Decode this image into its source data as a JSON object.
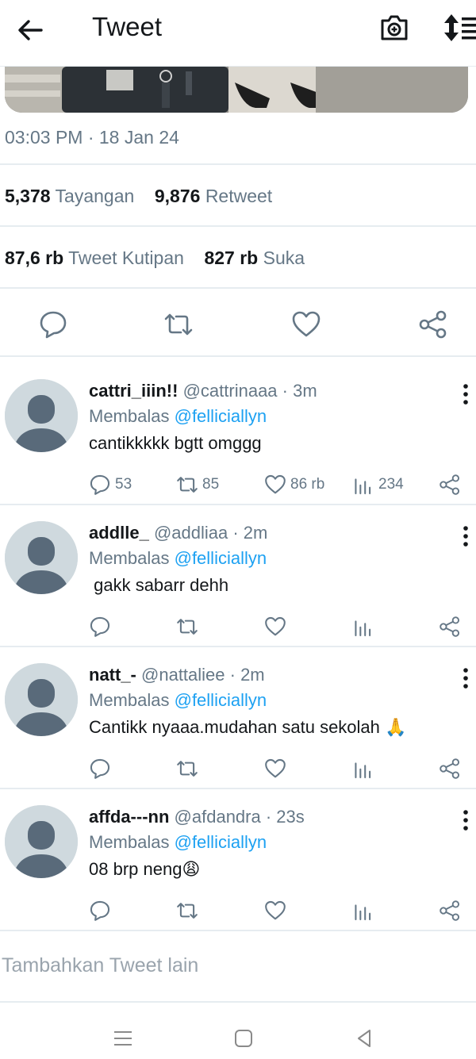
{
  "header": {
    "title": "Tweet"
  },
  "tweet": {
    "timestamp": "03:03 PM · 18 Jan 24",
    "views_count": "5,378",
    "views_label": "Tayangan",
    "retweets_count": "9,876",
    "retweets_label": "Retweet",
    "quotes_count": "87,6 rb",
    "quotes_label": "Tweet Kutipan",
    "likes_count": "827 rb",
    "likes_label": "Suka"
  },
  "replies": [
    {
      "name": "cattri_iiin!!",
      "handle": "@cattrinaaa · 3m",
      "reply_prefix": "Membalas",
      "mention": "@fellicially​n",
      "text": "cantikkkkk bgtt omggg",
      "replies": "53",
      "retweets": "85",
      "likes": "86 rb",
      "views": "234"
    },
    {
      "name": "addlle_",
      "handle": "@addliaa · 2m",
      "reply_prefix": "Membalas",
      "mention": "@felliciallyn",
      "text": " gakk sabarr dehh",
      "replies": "",
      "retweets": "",
      "likes": "",
      "views": ""
    },
    {
      "name": "natt_-",
      "handle": "@nattaliee · 2m",
      "reply_prefix": "Membalas",
      "mention": "@felliciallyn",
      "text": "Cantikk nyaaa.mudahan satu sekolah 🙏",
      "replies": "",
      "retweets": "",
      "likes": "",
      "views": ""
    },
    {
      "name": "affda---nn",
      "handle": "@afdandra · 23s",
      "reply_prefix": "Membalas",
      "mention": "@felliciallyn",
      "text": "08 brp neng😩",
      "replies": "",
      "retweets": "",
      "likes": "",
      "views": ""
    }
  ],
  "compose": {
    "placeholder": "Tambahkan Tweet lain"
  },
  "colors": {
    "accent": "#1da1f2",
    "muted": "#657786",
    "text": "#14171a",
    "divider": "#e6ecf0"
  }
}
